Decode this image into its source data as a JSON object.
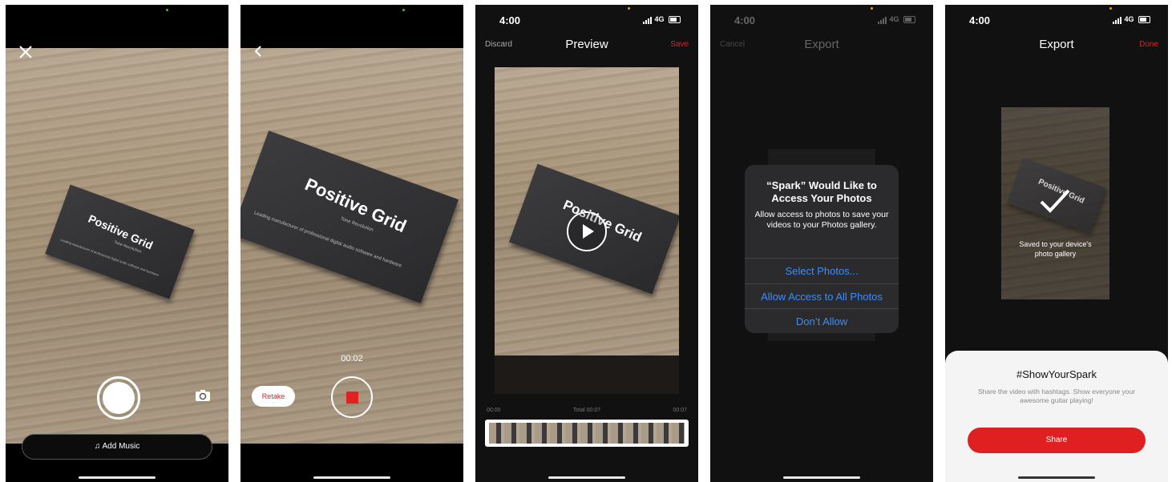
{
  "screen1": {
    "card_brand": "Positive Grid",
    "card_subtitle": "Tone Revolution",
    "card_tagline": "Leading manufacturer of professional digital audio software and hardware",
    "add_music_label": "Add Music"
  },
  "screen2": {
    "timer": "00:02",
    "retake_label": "Retake",
    "card_brand": "Positive Grid",
    "card_subtitle": "Tone Revolution",
    "card_tagline": "Leading manufacturer of professional digital audio software and hardware"
  },
  "screen3": {
    "time": "4:00",
    "network": "4G",
    "nav": {
      "left": "Discard",
      "title": "Preview",
      "right": "Save"
    },
    "card_brand": "Positive Grid",
    "timeline": {
      "start": "00:00",
      "total": "Total 00:07",
      "end": "00:07"
    },
    "colors": {
      "accent": "#e02020"
    }
  },
  "screen4": {
    "time": "4:00",
    "network": "4G",
    "nav": {
      "left": "Cancel",
      "title": "Export"
    },
    "alert": {
      "title": "“Spark” Would Like to Access Your Photos",
      "message": "Allow access to photos to save your videos to your Photos gallery.",
      "actions": [
        "Select Photos...",
        "Allow Access to All Photos",
        "Don’t Allow"
      ]
    }
  },
  "screen5": {
    "time": "4:00",
    "network": "4G",
    "nav": {
      "title": "Export",
      "right": "Done"
    },
    "card_brand": "Positive Grid",
    "saved_text": "Saved to your device's photo gallery",
    "sheet": {
      "title": "#ShowYourSpark",
      "description": "Share the video with hashtags. Show everyone your awesome guitar playing!",
      "share_label": "Share"
    }
  }
}
